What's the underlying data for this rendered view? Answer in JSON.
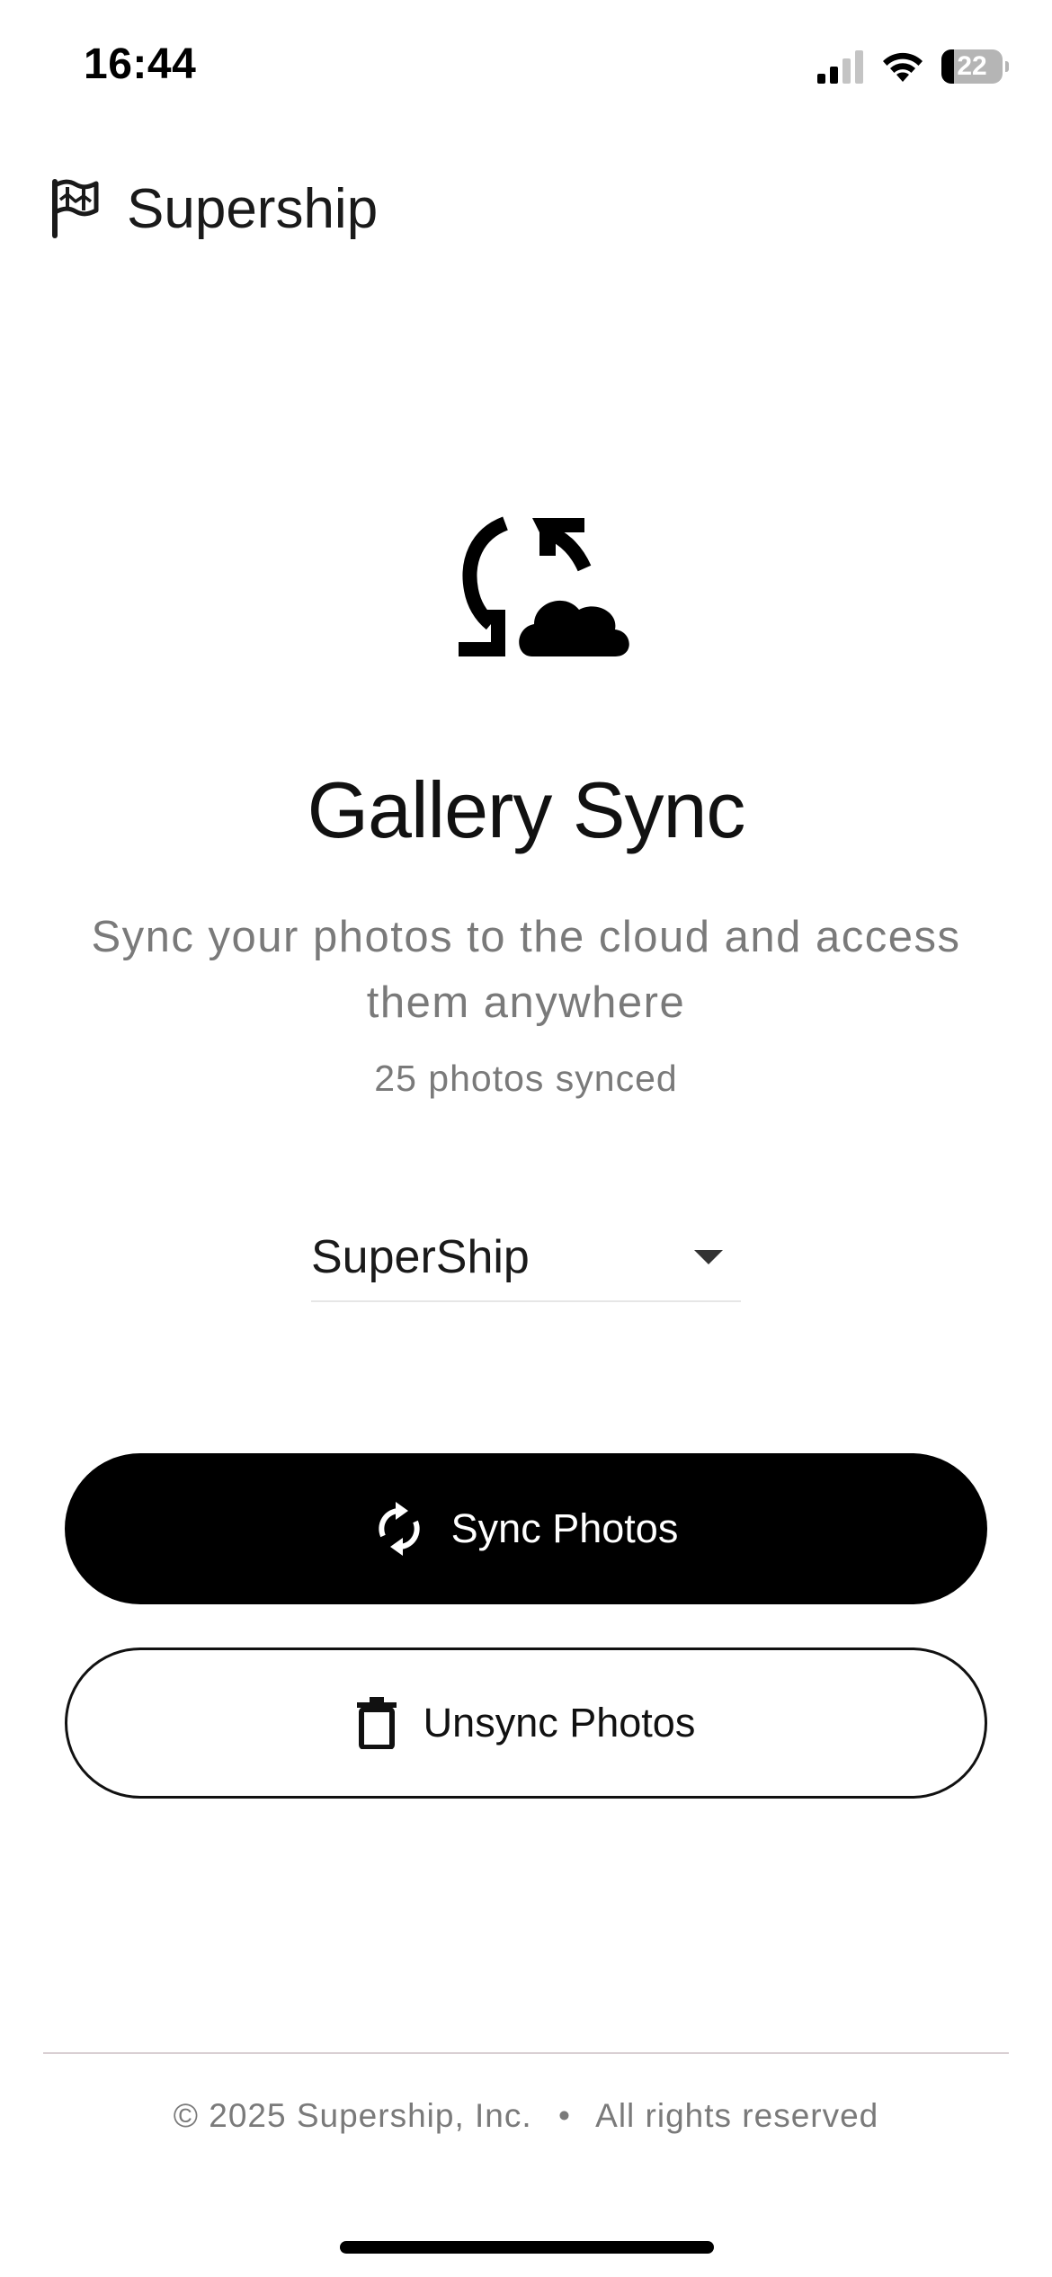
{
  "status_bar": {
    "time": "16:44",
    "battery_level": "22",
    "signal_bars_active": 2,
    "signal_bars_total": 4
  },
  "header": {
    "app_name": "Supership",
    "logo_icon": "flag-map-icon"
  },
  "hero": {
    "icon": "sync-cloud-icon",
    "title": "Gallery Sync",
    "subtitle": "Sync your photos to the cloud and access them anywhere",
    "sync_count": "25 photos synced"
  },
  "album_select": {
    "selected": "SuperShip"
  },
  "actions": {
    "sync_label": "Sync Photos",
    "sync_icon": "sync-icon",
    "unsync_label": "Unsync Photos",
    "unsync_icon": "trash-icon"
  },
  "footer": {
    "copyright": "© 2025 Supership, Inc.",
    "separator": "•",
    "rights": "All rights reserved"
  },
  "colors": {
    "primary": "#000000",
    "background": "#ffffff",
    "muted_text": "#7a7a7a",
    "divider": "#d9cfd3"
  }
}
